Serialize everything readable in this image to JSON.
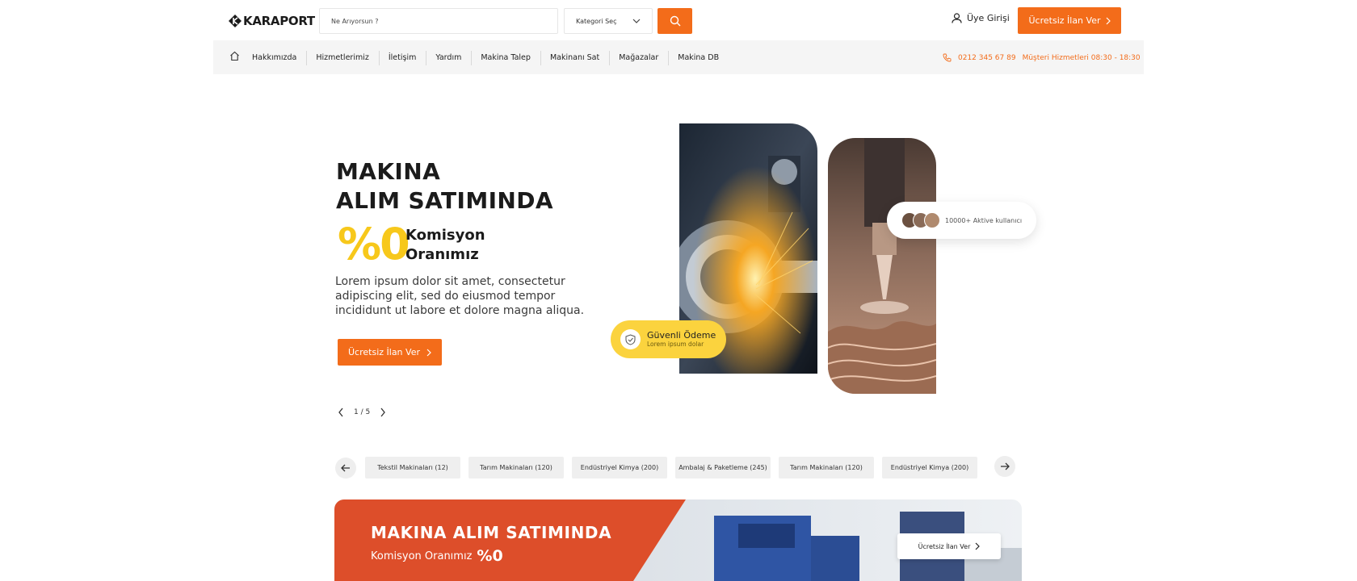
{
  "header": {
    "logo_text": "KARAPORT",
    "search_placeholder": "Ne Arıyorsun ?",
    "category_select": "Kategori Seç",
    "login_label": "Üye Girişi",
    "cta_label": "Ücretsiz İlan Ver"
  },
  "nav": {
    "items": [
      "Hakkımızda",
      "Hizmetlerimiz",
      "İletişim",
      "Yardım",
      "Makina Talep",
      "Makinanı Sat",
      "Mağazalar",
      "Makina DB"
    ],
    "phone": "0212 345 67 89",
    "hours": "Müşteri Hizmetleri 08:30 - 18:30"
  },
  "hero": {
    "title_line1": "MAKINA",
    "title_line2": "ALIM SATIMINDA",
    "zero": "%0",
    "komisyon_line1": "Komisyon",
    "komisyon_line2": "Oranımız",
    "description": "Lorem ipsum dolor sit amet, consectetur adipiscing elit, sed do eiusmod tempor incididunt ut labore et dolore magna aliqua.",
    "cta_label": "Ücretsiz İlan Ver",
    "pager": "1 / 5",
    "users_badge": "10000+ Aktive kullanıcı",
    "secure_title": "Güvenli Ödeme",
    "secure_sub": "Lorem ipsum dolar"
  },
  "categories": [
    "Tekstil Makinaları (12)",
    "Tarım Makinaları (120)",
    "Endüstriyel Kimya (200)",
    "Ambalaj & Paketleme (245)",
    "Tarım Makinaları (120)",
    "Endüstriyel Kimya (200)"
  ],
  "banner": {
    "title": "MAKINA ALIM SATIMINDA",
    "subtitle": "Komisyon Oranımız",
    "zero": "%0",
    "cta_label": "Ücretsiz İlan Ver"
  },
  "colors": {
    "accent": "#f36c1a",
    "yellow": "#f7c81b",
    "banner_red": "#dd4e2a",
    "navbar_bg": "#f5f5f5"
  }
}
